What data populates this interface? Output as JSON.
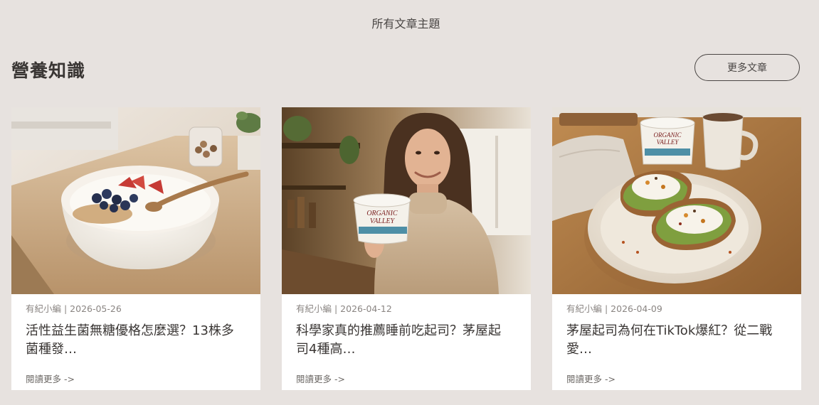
{
  "header": {
    "topics_link": "所有文章主題"
  },
  "section": {
    "title": "營養知識",
    "more_button": "更多文章"
  },
  "cards": [
    {
      "meta": "有紀小編 | 2026-05-26",
      "title": "活性益生菌無糖優格怎麼選？13株多菌種發…",
      "read_more": "閱讀更多 ->",
      "image": "yogurt-bowl-photo"
    },
    {
      "meta": "有紀小編 | 2026-04-12",
      "title": "科學家真的推薦睡前吃起司？茅屋起司4種高…",
      "read_more": "閱讀更多 ->",
      "image": "woman-holding-cottage-cheese-photo",
      "product_label": "ORGANIC VALLEY"
    },
    {
      "meta": "有紀小編 | 2026-04-09",
      "title": "茅屋起司為何在TikTok爆紅？從二戰愛…",
      "read_more": "閱讀更多 ->",
      "image": "cottage-cheese-toast-photo",
      "product_label": "ORGANIC VALLEY"
    }
  ]
}
